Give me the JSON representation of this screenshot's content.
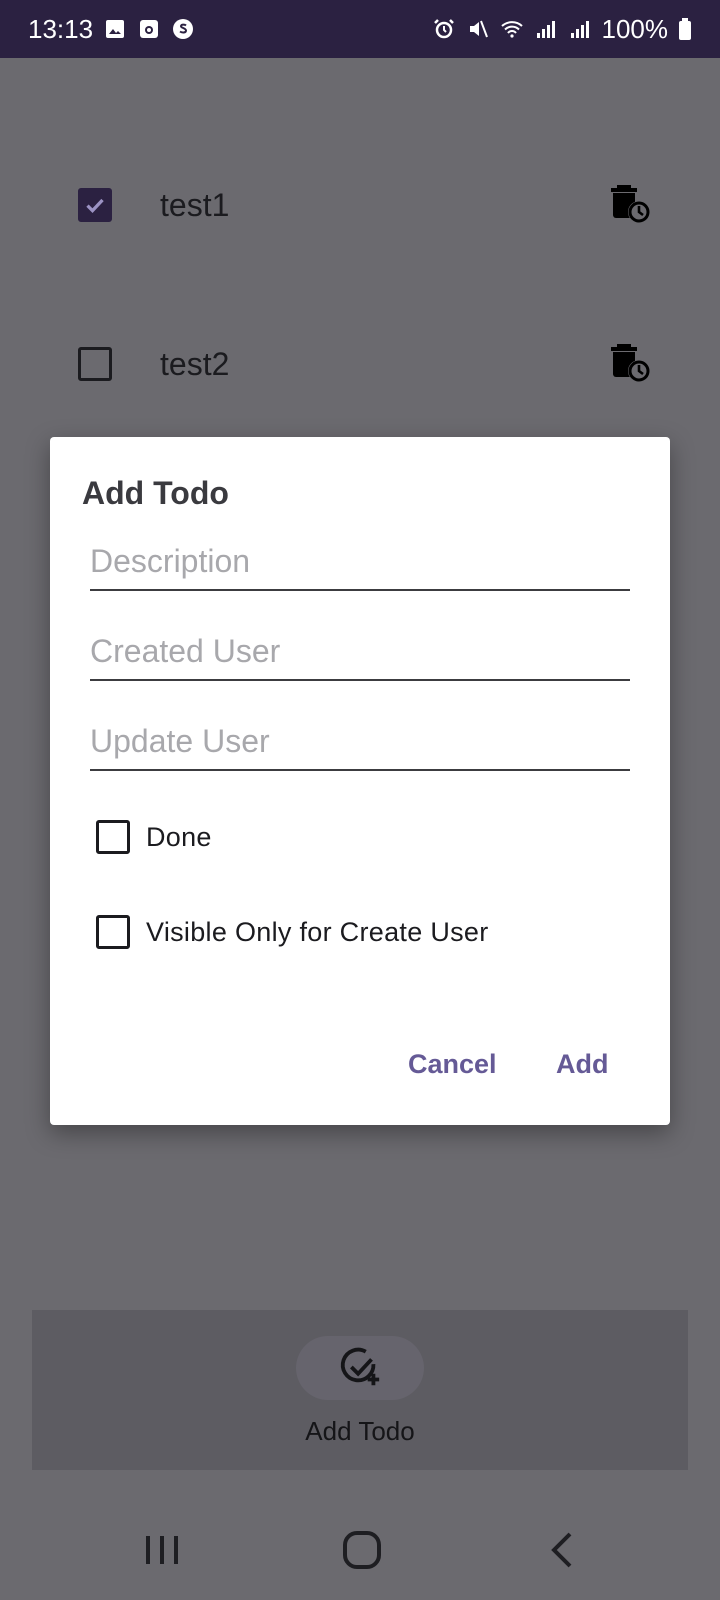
{
  "status_bar": {
    "time": "13:13",
    "battery": "100%",
    "left_icons": [
      "gallery-icon",
      "camera-icon",
      "s-app-icon"
    ],
    "right_icons": [
      "alarm-icon",
      "mute-icon",
      "wifi-icon",
      "signal-icon",
      "signal-icon",
      "battery-icon"
    ]
  },
  "todos": [
    {
      "label": "test1",
      "checked": true
    },
    {
      "label": "test2",
      "checked": false
    }
  ],
  "dialog": {
    "title": "Add Todo",
    "fields": {
      "description": {
        "placeholder": "Description",
        "value": ""
      },
      "created_user": {
        "placeholder": "Created User",
        "value": ""
      },
      "update_user": {
        "placeholder": "Update User",
        "value": ""
      }
    },
    "checkboxes": {
      "done": {
        "label": "Done",
        "checked": false
      },
      "visible_only": {
        "label": "Visible Only for Create User",
        "checked": false
      }
    },
    "cancel_label": "Cancel",
    "add_label": "Add"
  },
  "bottom_bar": {
    "add_label": "Add Todo"
  },
  "colors": {
    "scrim": "#6b6a6f",
    "status_bar": "#2b2141",
    "accent": "#655a96"
  }
}
